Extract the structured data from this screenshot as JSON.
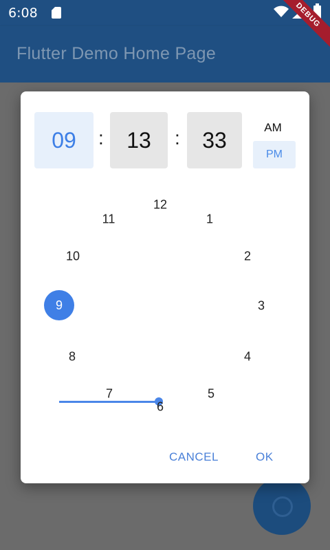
{
  "status_bar": {
    "time": "6:08",
    "icons": [
      "sim-card-icon",
      "wifi-icon",
      "signal-icon",
      "battery-icon"
    ]
  },
  "app_bar": {
    "title": "Flutter Demo Home Page",
    "debug_banner": "DEBUG"
  },
  "time_picker": {
    "hour": "09",
    "minute": "13",
    "second": "33",
    "separator": ":",
    "am_label": "AM",
    "pm_label": "PM",
    "selected_period": "PM",
    "dial": {
      "selected_hour": "9",
      "numbers": [
        "12",
        "1",
        "2",
        "3",
        "4",
        "5",
        "6",
        "7",
        "8",
        "9",
        "10",
        "11"
      ]
    },
    "cancel_label": "CANCEL",
    "ok_label": "OK"
  },
  "fab": {
    "icon": "add-icon"
  },
  "colors": {
    "primary": "#1f4f82",
    "accent": "#3f7fe6",
    "accent_light": "#e7f0fb",
    "selected_box": "#e6e6e6",
    "scrim": "#6b6b6b",
    "debug_ribbon": "#a51d2d"
  }
}
